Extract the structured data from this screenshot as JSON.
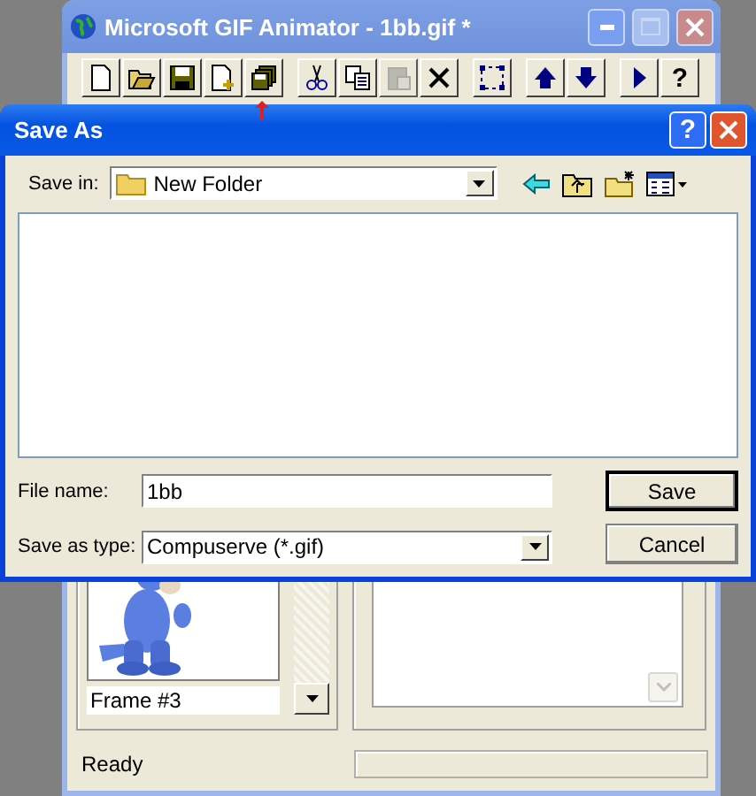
{
  "main_window": {
    "title": "Microsoft GIF Animator - 1bb.gif *",
    "toolbar": {
      "groups": [
        [
          {
            "kind": "new",
            "disabled": false
          },
          {
            "kind": "open",
            "disabled": false
          },
          {
            "kind": "save",
            "disabled": false
          },
          {
            "kind": "insert",
            "disabled": false
          },
          {
            "kind": "save-as",
            "disabled": false
          }
        ],
        [
          {
            "kind": "cut",
            "disabled": false
          },
          {
            "kind": "copy",
            "disabled": false
          },
          {
            "kind": "paste",
            "disabled": true
          },
          {
            "kind": "delete",
            "disabled": false
          }
        ],
        [
          {
            "kind": "select-all",
            "disabled": false
          }
        ],
        [
          {
            "kind": "up",
            "disabled": false
          },
          {
            "kind": "down",
            "disabled": false
          }
        ],
        [
          {
            "kind": "play",
            "disabled": false
          },
          {
            "kind": "help",
            "label": "?",
            "disabled": false
          }
        ]
      ]
    },
    "frame": {
      "label": "Frame #3"
    },
    "status_bar": {
      "text": "Ready"
    }
  },
  "dialog": {
    "title": "Save As",
    "help_button": "?",
    "save_in": {
      "label": "Save in:",
      "value": "New Folder"
    },
    "file_name": {
      "label": "File name:",
      "value": "1bb"
    },
    "save_as_type": {
      "label": "Save as type:",
      "value": "Compuserve (*.gif)"
    },
    "buttons": [
      {
        "label": "Save",
        "default": true
      },
      {
        "label": "Cancel",
        "default": false
      }
    ]
  }
}
